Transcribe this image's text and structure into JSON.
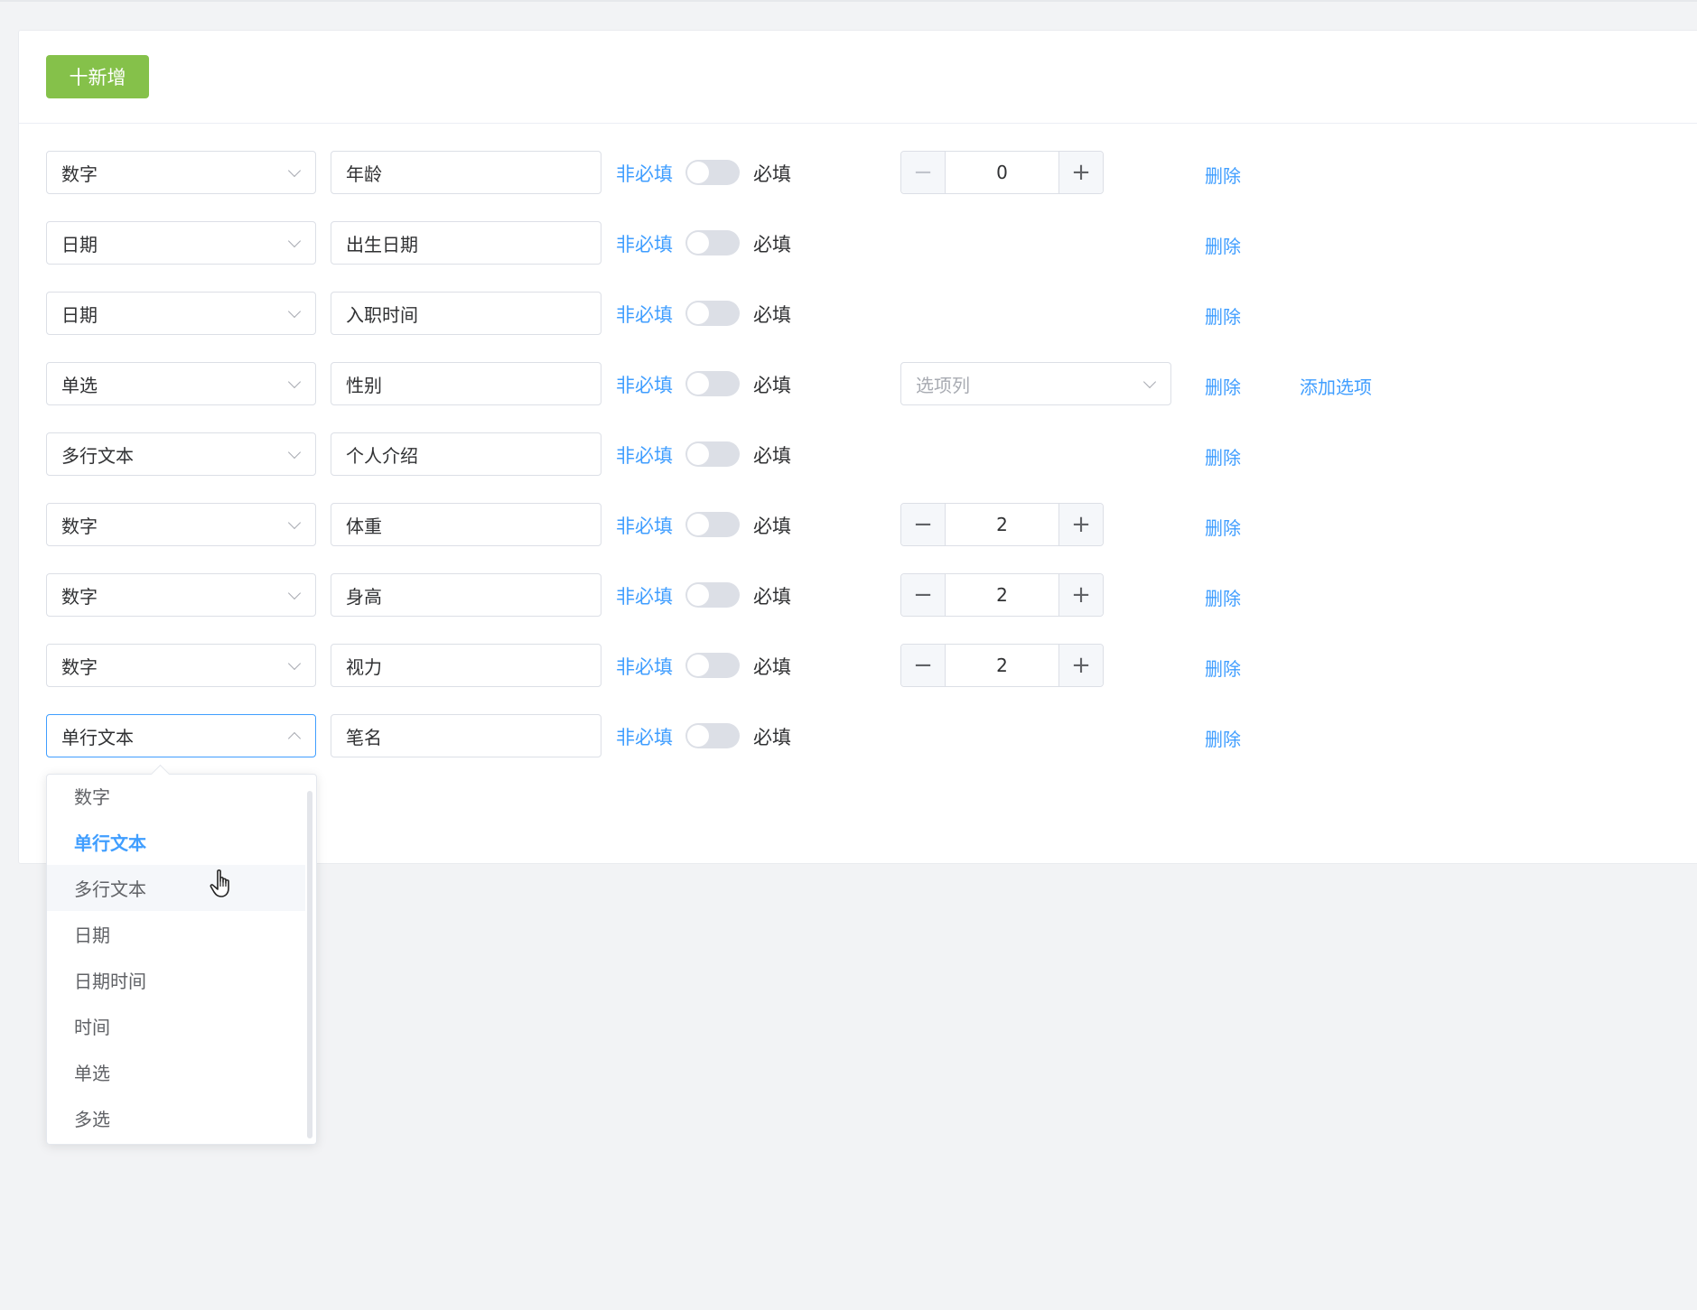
{
  "toolbar": {
    "add_label": "十新增"
  },
  "labels": {
    "optional": "非必填",
    "required": "必填",
    "delete": "删除"
  },
  "rows": [
    {
      "type": "数字",
      "name": "年龄",
      "stepper": {
        "value": "0",
        "minus": "−",
        "plus": "+",
        "minus_disabled": true
      }
    },
    {
      "type": "日期",
      "name": "出生日期"
    },
    {
      "type": "日期",
      "name": "入职时间"
    },
    {
      "type": "单选",
      "name": "性别",
      "option_select_placeholder": "选项列",
      "add_option_label": "添加选项"
    },
    {
      "type": "多行文本",
      "name": "个人介绍"
    },
    {
      "type": "数字",
      "name": "体重",
      "stepper": {
        "value": "2",
        "minus": "−",
        "plus": "+"
      }
    },
    {
      "type": "数字",
      "name": "身高",
      "stepper": {
        "value": "2",
        "minus": "−",
        "plus": "+"
      }
    },
    {
      "type": "数字",
      "name": "视力",
      "stepper": {
        "value": "2",
        "minus": "−",
        "plus": "+"
      }
    },
    {
      "type": "单行文本",
      "name": "笔名",
      "focused": true
    }
  ],
  "dropdown": {
    "options": [
      "数字",
      "单行文本",
      "多行文本",
      "日期",
      "日期时间",
      "时间",
      "单选",
      "多选"
    ],
    "selected_index": 1,
    "hover_index": 2
  },
  "colors": {
    "primary": "#409eff",
    "success": "#85c14a",
    "border": "#dcdfe6",
    "background": "#f2f3f5"
  }
}
